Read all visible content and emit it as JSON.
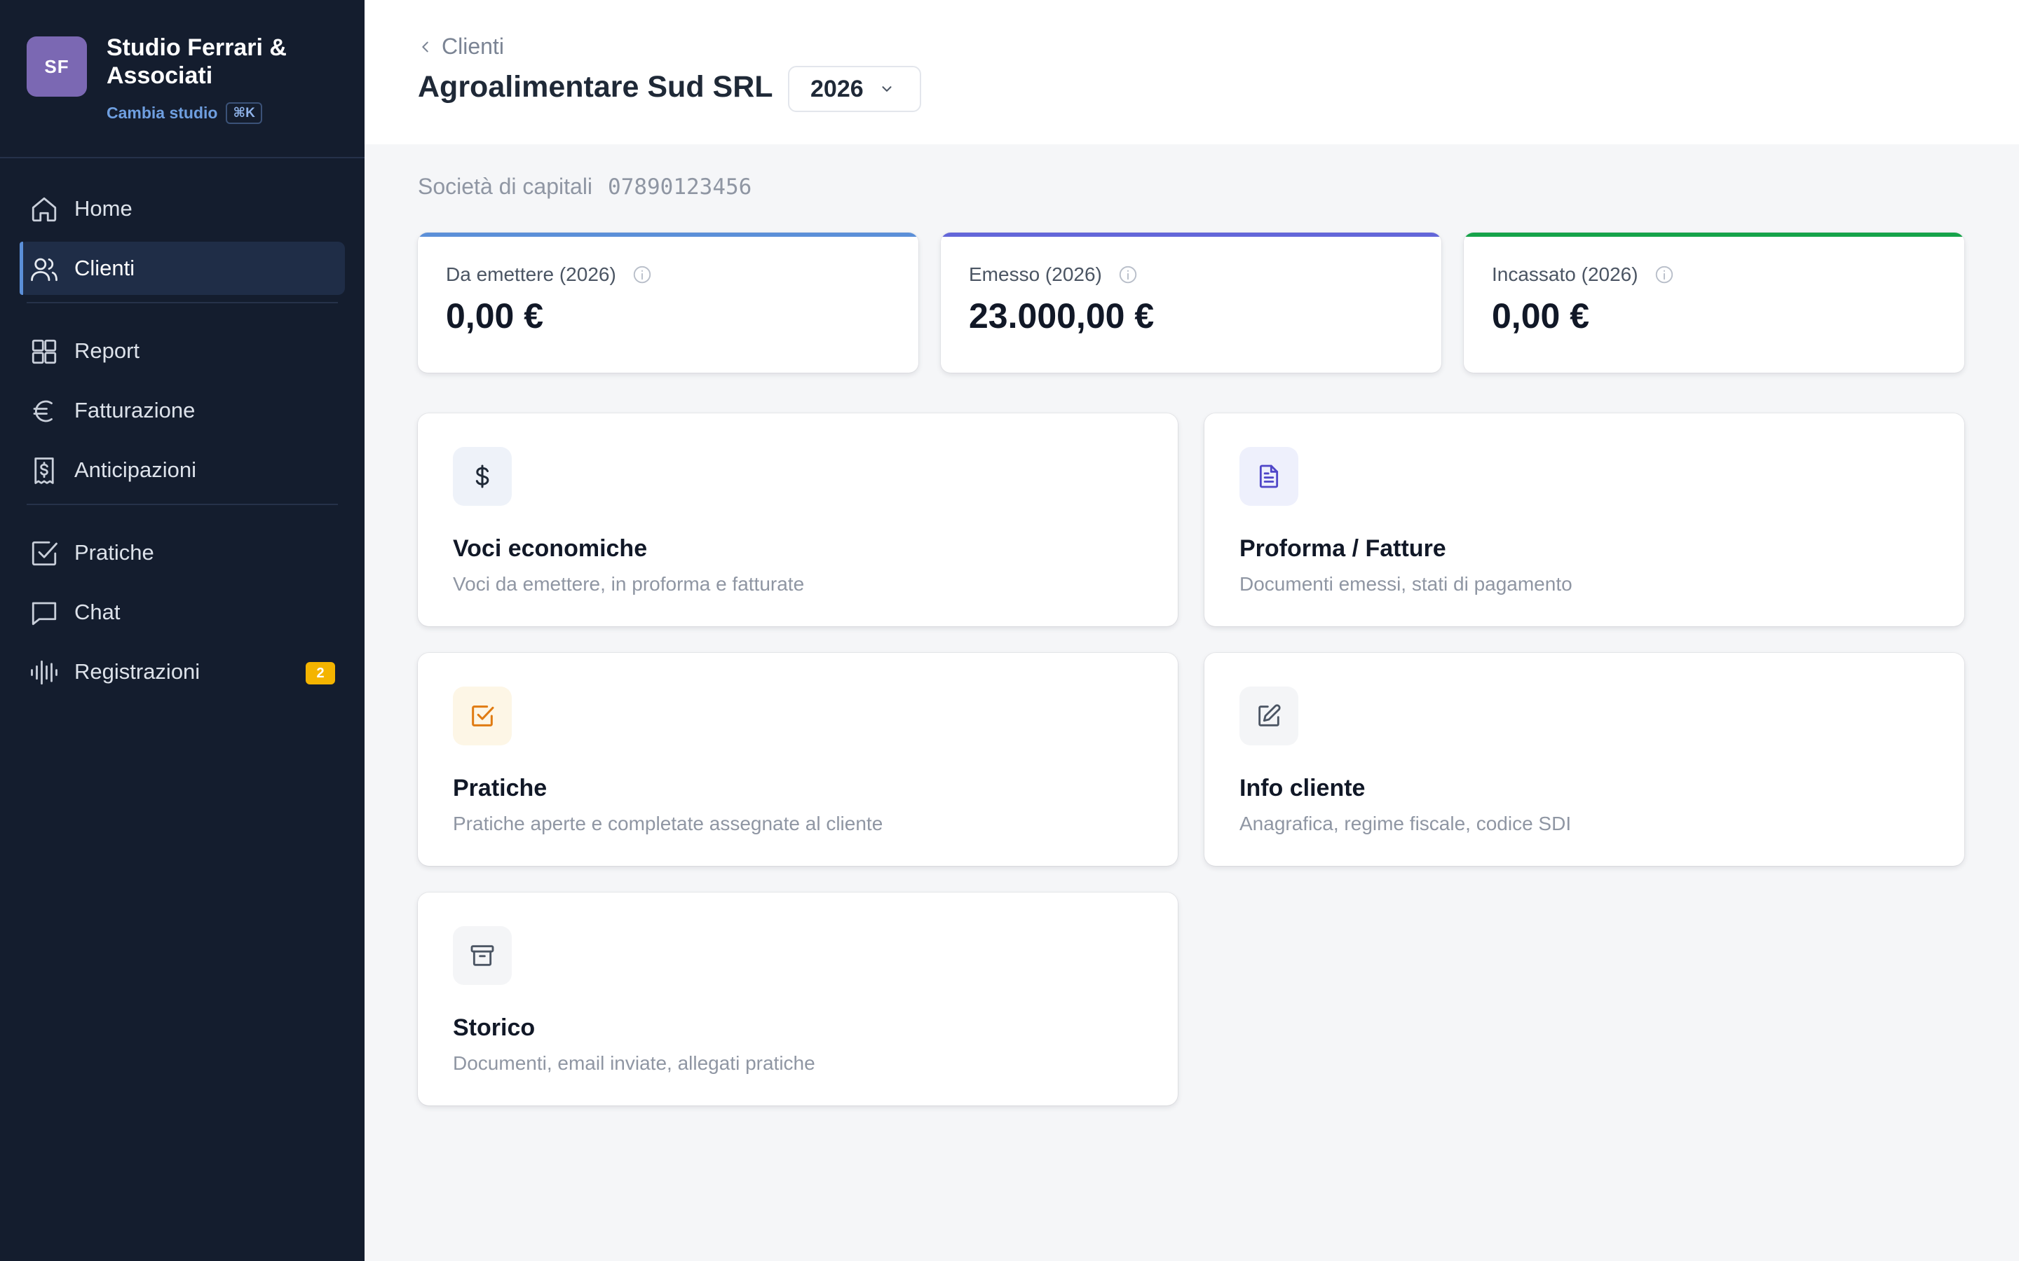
{
  "brand": {
    "initials": "SF",
    "name": "Studio Ferrari & Associati",
    "switch_label": "Cambia studio",
    "shortcut": "⌘K"
  },
  "nav": {
    "items": [
      {
        "label": "Home",
        "icon": "home-icon"
      },
      {
        "label": "Clienti",
        "icon": "users-icon",
        "active": true
      },
      {
        "label": "Report",
        "icon": "grid-icon"
      },
      {
        "label": "Fatturazione",
        "icon": "euro-icon"
      },
      {
        "label": "Anticipazioni",
        "icon": "receipt-icon"
      },
      {
        "label": "Pratiche",
        "icon": "checkbox-icon"
      },
      {
        "label": "Chat",
        "icon": "chat-icon"
      },
      {
        "label": "Registrazioni",
        "icon": "waveform-icon",
        "badge": "2"
      }
    ]
  },
  "header": {
    "breadcrumb": "Clienti",
    "title": "Agroalimentare Sud SRL",
    "year": "2026"
  },
  "client": {
    "type": "Società di capitali",
    "vat": "07890123456"
  },
  "stats": [
    {
      "label": "Da emettere (2026)",
      "value": "0,00 €",
      "color": "#5b8fd8"
    },
    {
      "label": "Emesso (2026)",
      "value": "23.000,00 €",
      "color": "#6366d9"
    },
    {
      "label": "Incassato (2026)",
      "value": "0,00 €",
      "color": "#16a34a"
    }
  ],
  "cards": [
    {
      "title": "Voci economiche",
      "desc": "Voci da emettere, in proforma e fatturate",
      "icon": "dollar-icon"
    },
    {
      "title": "Proforma / Fatture",
      "desc": "Documenti emessi, stati di pagamento",
      "icon": "document-icon"
    },
    {
      "title": "Pratiche",
      "desc": "Pratiche aperte e completate assegnate al cliente",
      "icon": "checkbox-icon"
    },
    {
      "title": "Info cliente",
      "desc": "Anagrafica, regime fiscale, codice SDI",
      "icon": "edit-icon"
    },
    {
      "title": "Storico",
      "desc": "Documenti, email inviate, allegati pratiche",
      "icon": "archive-icon"
    }
  ],
  "colors": {
    "sidebar_bg": "#141d2e",
    "accent": "#5b8fd8",
    "badge": "#f4b400"
  }
}
